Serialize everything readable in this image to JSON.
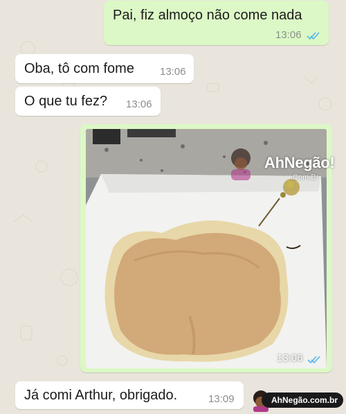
{
  "chat": {
    "messages": [
      {
        "direction": "outgoing",
        "text": "Pai, fiz almoço não come nada",
        "time": "13:06",
        "status": "read-ticks-icon"
      },
      {
        "direction": "incoming",
        "text": "Oba, tô com fome",
        "time": "13:06"
      },
      {
        "direction": "incoming",
        "text": "O que tu fez?",
        "time": "13:06"
      },
      {
        "direction": "outgoing",
        "type": "photo",
        "time": "13:06",
        "status": "read-ticks-icon"
      },
      {
        "direction": "incoming",
        "text": "Já comi Arthur, obrigado.",
        "time": "13:09"
      }
    ]
  },
  "watermark": {
    "logo_text": "AhNegão!",
    "domain_small": ".Com.Br",
    "badge_text": "AhNegão.com.br"
  },
  "colors": {
    "background": "#e9e5dc",
    "incoming_bubble": "#ffffff",
    "outgoing_bubble": "#dcf8c6",
    "read_ticks": "#4fb6ec"
  }
}
